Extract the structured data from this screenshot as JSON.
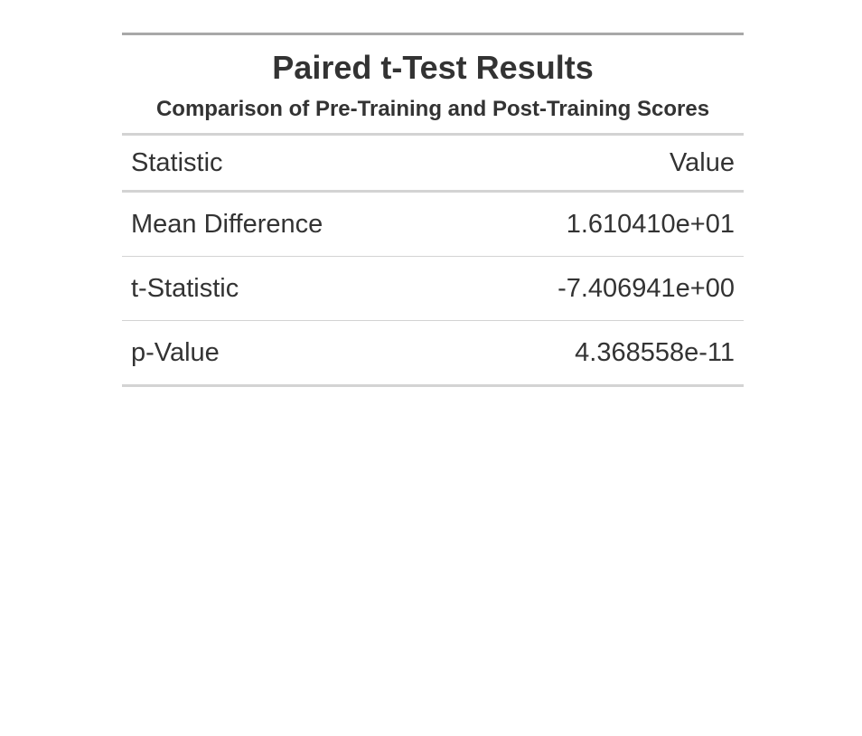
{
  "table": {
    "title": "Paired t-Test Results",
    "subtitle": "Comparison of Pre-Training and Post-Training Scores",
    "columns": [
      "Statistic",
      "Value"
    ],
    "rows": [
      {
        "statistic": "Mean Difference",
        "value": "1.610410e+01"
      },
      {
        "statistic": "t-Statistic",
        "value": "-7.406941e+00"
      },
      {
        "statistic": "p-Value",
        "value": "4.368558e-11"
      }
    ]
  }
}
